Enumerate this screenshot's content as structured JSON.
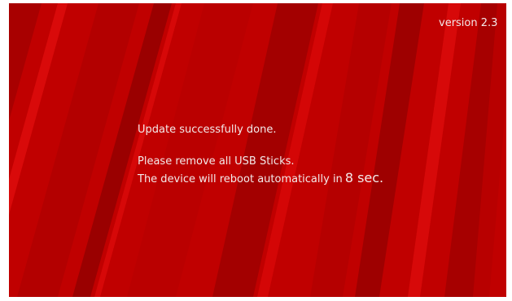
{
  "screen": {
    "version": "version 2.3",
    "message_done": "Update successfully done.",
    "message_remove": "Please remove all USB Sticks.",
    "message_reboot_prefix": "The device will reboot automatically in",
    "countdown": "8 sec."
  },
  "colors": {
    "background": "#c00000",
    "stripe_dark": "#9e0000",
    "stripe_light": "#d40606",
    "text": "#f3eaea"
  }
}
